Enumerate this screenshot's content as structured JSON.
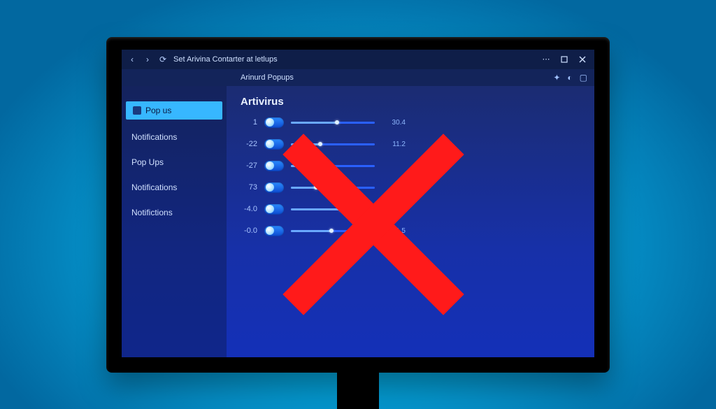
{
  "titlebar": {
    "back": "‹",
    "forward": "›",
    "refresh": "⟳",
    "title": "Set Arivina Contarter at letlups",
    "more": "⋯"
  },
  "subheader": {
    "label": "Arinurd Popups"
  },
  "sidebar": {
    "items": [
      {
        "label": "Pop us",
        "active": true
      },
      {
        "label": "Notifications",
        "active": false
      },
      {
        "label": "Pop Ups",
        "active": false
      },
      {
        "label": "Notifications",
        "active": false
      },
      {
        "label": "Notifictions",
        "active": false
      }
    ]
  },
  "section": {
    "title": "Artivirus"
  },
  "rows": [
    {
      "label": "1",
      "pct": 55,
      "value": "30.4"
    },
    {
      "label": "-22",
      "pct": 35,
      "value": "11.2"
    },
    {
      "label": "-27",
      "pct": 42,
      "value": ""
    },
    {
      "label": "73",
      "pct": 30,
      "value": ""
    },
    {
      "label": "-4.0",
      "pct": 60,
      "value": "2.6"
    },
    {
      "label": "-0.0",
      "pct": 48,
      "value": "71.5"
    }
  ],
  "overlay": {
    "kind": "red-x"
  }
}
